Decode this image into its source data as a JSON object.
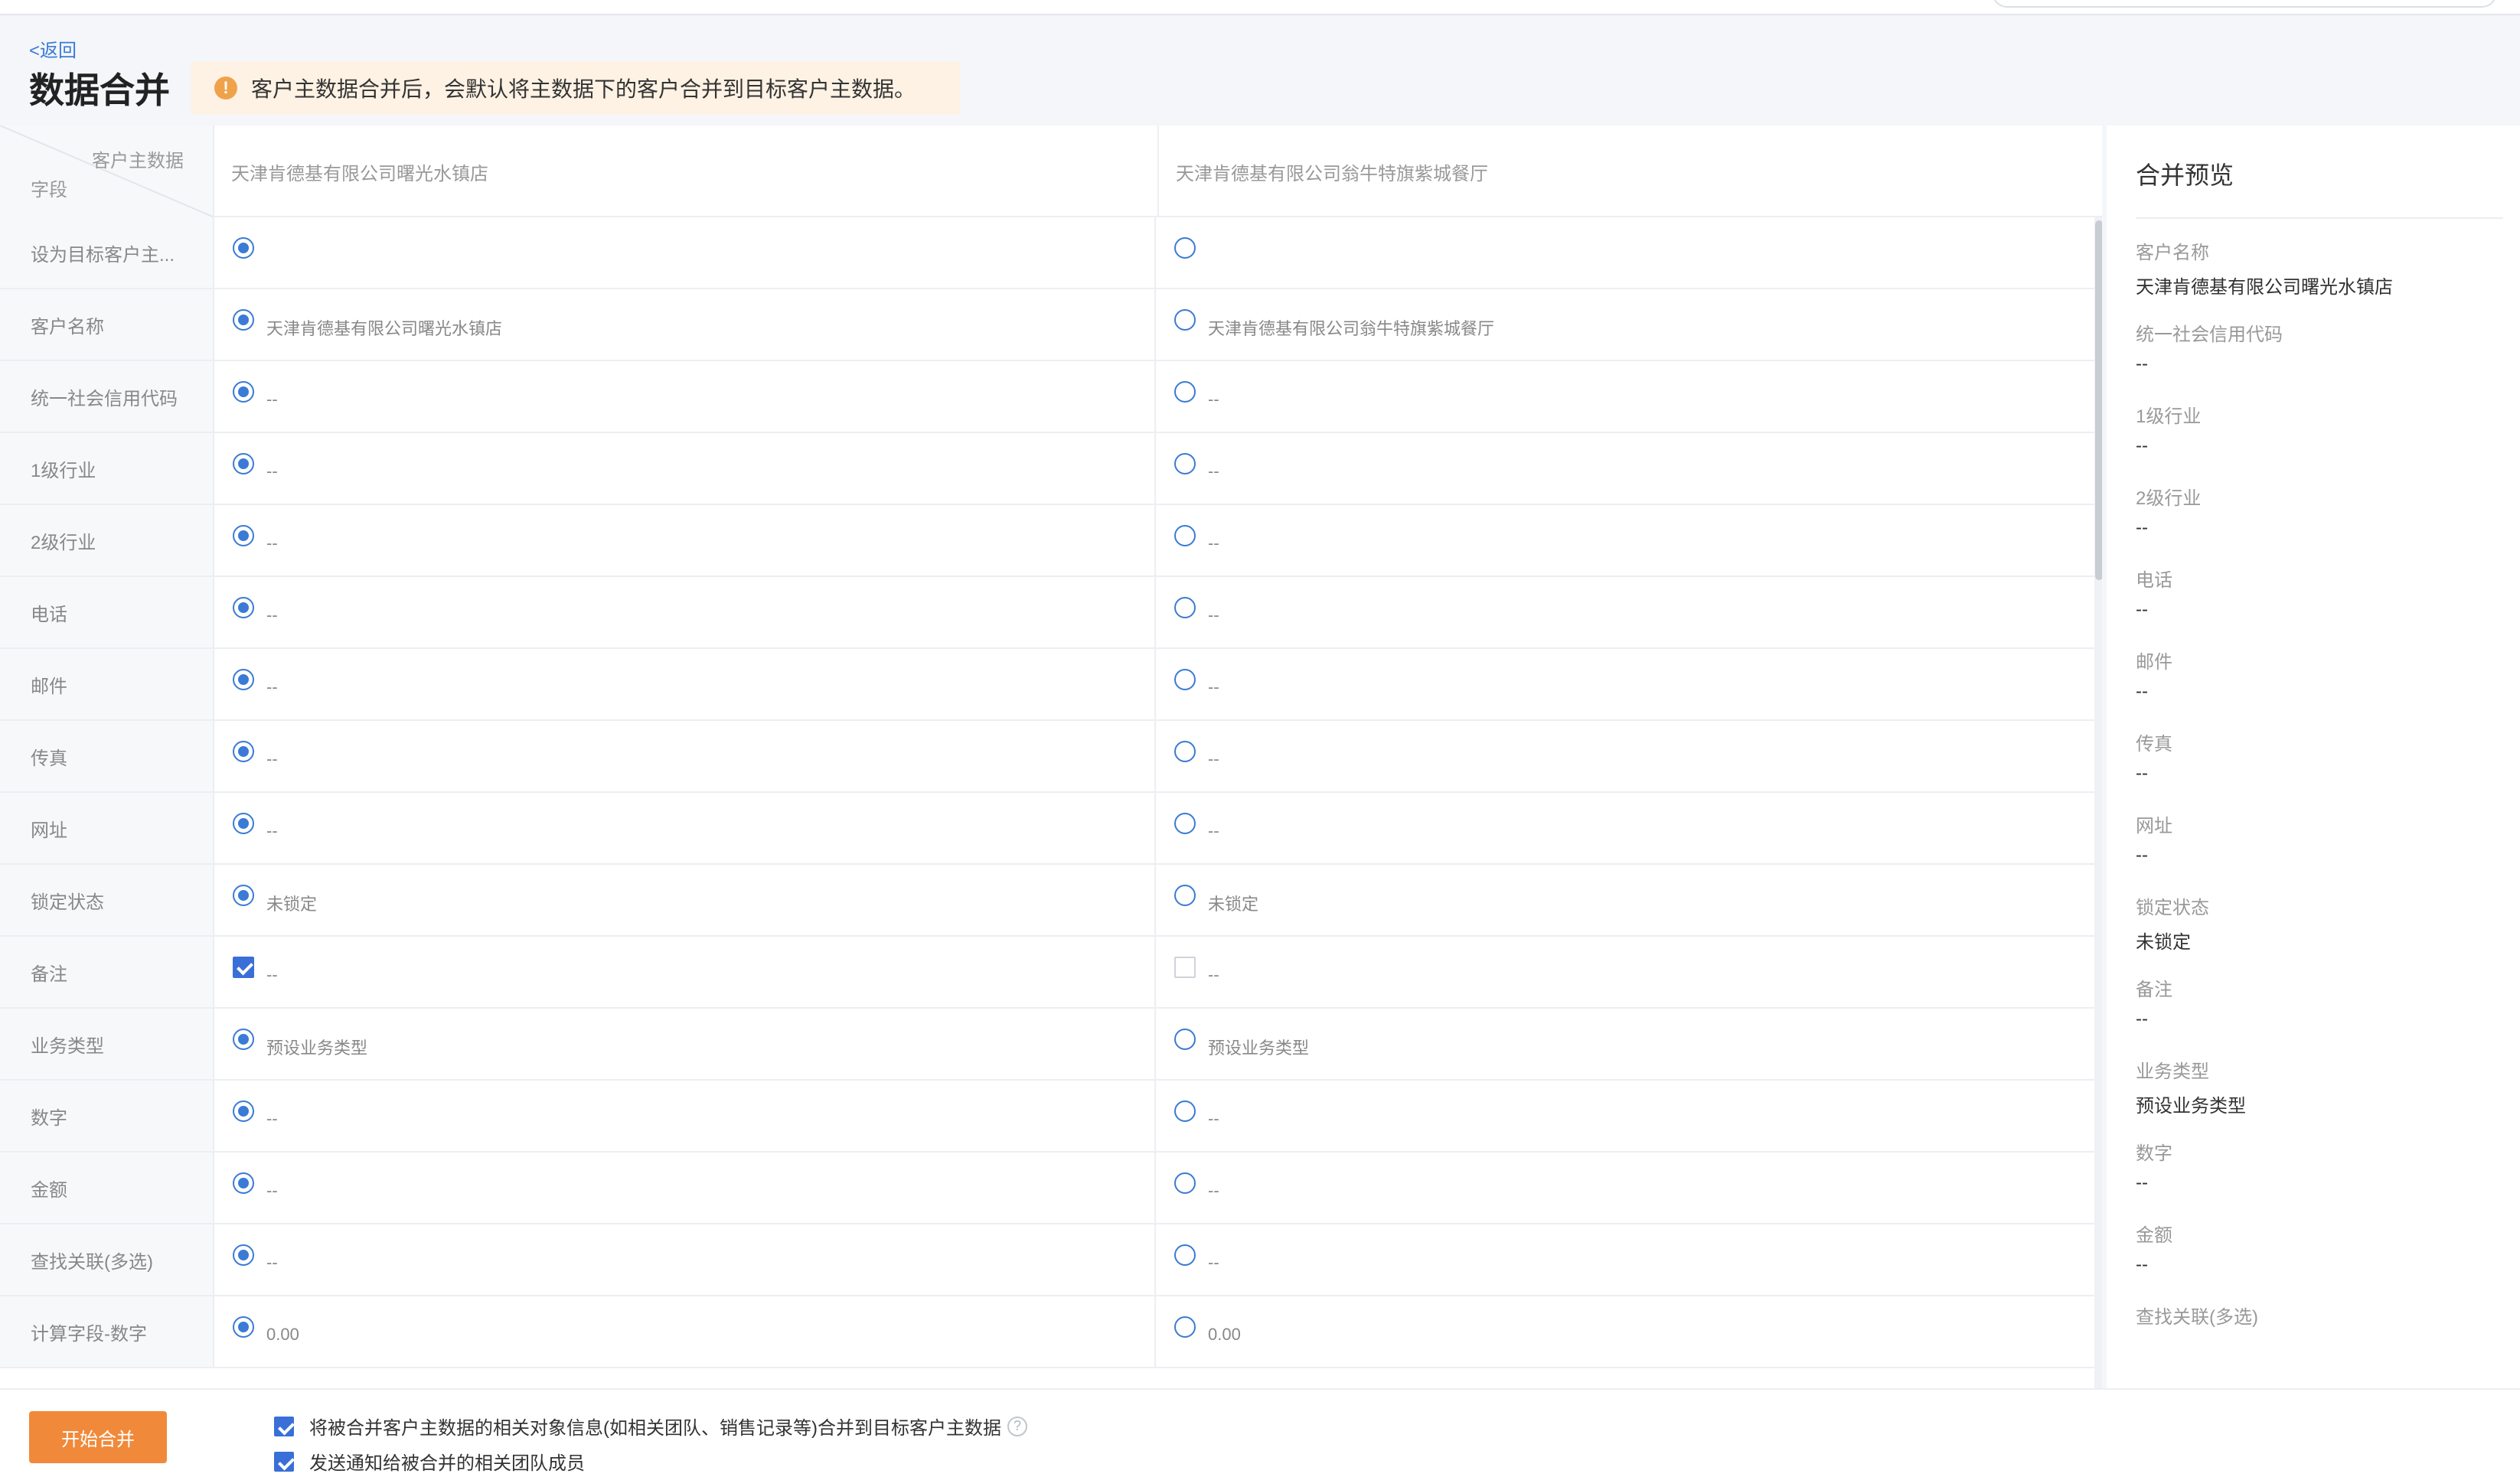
{
  "nav": {
    "back_label": "<返回"
  },
  "page": {
    "title": "数据合并"
  },
  "notice": {
    "icon": "warning-icon",
    "text": "客户主数据合并后，会默认将主数据下的客户合并到目标客户主数据。"
  },
  "table": {
    "corner_top": "客户主数据",
    "corner_bottom": "字段",
    "columns": [
      "天津肯德基有限公司曙光水镇店",
      "天津肯德基有限公司翁牛特旗紫城餐厅"
    ],
    "rows": [
      {
        "label": "设为目标客户主...",
        "control": "radio",
        "selected": "a",
        "a": "",
        "b": ""
      },
      {
        "label": "客户名称",
        "control": "radio",
        "selected": "a",
        "a": "天津肯德基有限公司曙光水镇店",
        "b": "天津肯德基有限公司翁牛特旗紫城餐厅"
      },
      {
        "label": "统一社会信用代码",
        "control": "radio",
        "selected": "a",
        "a": "--",
        "b": "--"
      },
      {
        "label": "1级行业",
        "control": "radio",
        "selected": "a",
        "a": "--",
        "b": "--"
      },
      {
        "label": "2级行业",
        "control": "radio",
        "selected": "a",
        "a": "--",
        "b": "--"
      },
      {
        "label": "电话",
        "control": "radio",
        "selected": "a",
        "a": "--",
        "b": "--"
      },
      {
        "label": "邮件",
        "control": "radio",
        "selected": "a",
        "a": "--",
        "b": "--"
      },
      {
        "label": "传真",
        "control": "radio",
        "selected": "a",
        "a": "--",
        "b": "--"
      },
      {
        "label": "网址",
        "control": "radio",
        "selected": "a",
        "a": "--",
        "b": "--"
      },
      {
        "label": "锁定状态",
        "control": "radio",
        "selected": "a",
        "a": "未锁定",
        "b": "未锁定"
      },
      {
        "label": "备注",
        "control": "checkbox",
        "selected": "a",
        "a": "--",
        "b": "--"
      },
      {
        "label": "业务类型",
        "control": "radio",
        "selected": "a",
        "a": "预设业务类型",
        "b": "预设业务类型"
      },
      {
        "label": "数字",
        "control": "radio",
        "selected": "a",
        "a": "--",
        "b": "--"
      },
      {
        "label": "金额",
        "control": "radio",
        "selected": "a",
        "a": "--",
        "b": "--"
      },
      {
        "label": "查找关联(多选)",
        "control": "radio",
        "selected": "a",
        "a": "--",
        "b": "--"
      },
      {
        "label": "计算字段-数字",
        "control": "radio",
        "selected": "a",
        "a": "0.00",
        "b": "0.00"
      }
    ]
  },
  "preview": {
    "title": "合并预览",
    "items": [
      {
        "label": "客户名称",
        "value": "天津肯德基有限公司曙光水镇店"
      },
      {
        "label": "统一社会信用代码",
        "value": "--"
      },
      {
        "label": "1级行业",
        "value": "--"
      },
      {
        "label": "2级行业",
        "value": "--"
      },
      {
        "label": "电话",
        "value": "--"
      },
      {
        "label": "邮件",
        "value": "--"
      },
      {
        "label": "传真",
        "value": "--"
      },
      {
        "label": "网址",
        "value": "--"
      },
      {
        "label": "锁定状态",
        "value": "未锁定"
      },
      {
        "label": "备注",
        "value": "--"
      },
      {
        "label": "业务类型",
        "value": "预设业务类型"
      },
      {
        "label": "数字",
        "value": "--"
      },
      {
        "label": "金额",
        "value": "--"
      },
      {
        "label": "查找关联(多选)",
        "value": ""
      }
    ]
  },
  "footer": {
    "merge_label": "开始合并",
    "options": [
      {
        "text": "将被合并客户主数据的相关对象信息(如相关团队、销售记录等)合并到目标客户主数据",
        "checked": true,
        "help": "?"
      },
      {
        "text": "发送通知给被合并的相关团队成员",
        "checked": true
      }
    ]
  },
  "colors": {
    "accent": "#3a7bd5",
    "primary_button": "#f08a3a",
    "notice_bg": "#fdf2e4",
    "warning": "#f0a24b"
  }
}
